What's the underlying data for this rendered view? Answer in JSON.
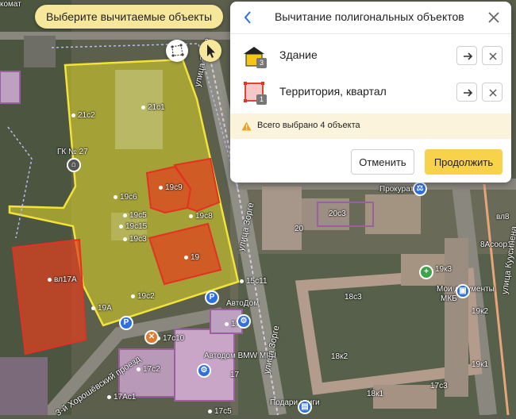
{
  "hint": "Выберите вычитаемые объекты",
  "panel": {
    "title": "Вычитание полигональных объектов",
    "items": [
      {
        "label": "Здание",
        "count": "3",
        "icon": "building-icon"
      },
      {
        "label": "Территория, квартал",
        "count": "1",
        "icon": "territory-icon"
      }
    ],
    "warning": "Всего выбрано 4 объекта",
    "cancel": "Отменить",
    "continue": "Продолжить"
  },
  "colors": {
    "accent": "#f7d24a",
    "hint_bg": "#f6e79a",
    "link_blue": "#2f6fde",
    "subtract_red": "#e0401f",
    "selection_yellow": "#f2e23a"
  },
  "map": {
    "labels": {
      "kommat": "комат",
      "gk27": "ГК № 27",
      "b21c1": "21с1",
      "b21c2": "21с2",
      "b19c6": "19с6",
      "b19c5": "19с5",
      "b19c15": "19с15",
      "b19c3": "19с3",
      "b19c8": "19с8",
      "b19c9": "19с9",
      "b19": "19",
      "b19c2": "19с2",
      "b19a": "19А",
      "b15c11": "15с11",
      "vl17a": "вл17А",
      "b17c2a": "17с2",
      "b17c10": "17с10",
      "b17c2b": "17с2",
      "b17": "17",
      "b17ac1": "17Ас1",
      "b17c5": "17с5",
      "b20": "20",
      "b20c3": "20с3",
      "b18c3": "18с3",
      "b18k2": "18к2",
      "b18k1": "18к1",
      "b17c3": "17с3",
      "b19k3": "19к3",
      "b19k2": "19к2",
      "b19k1": "19к1",
      "b8acoor": "8Асоор1",
      "b8": "вл8",
      "avtodom": "АвтоДом",
      "bmw": "Автодом BMW MINI",
      "prokuratura": "Прокуратура",
      "moi_docs": "Мои документы",
      "mkb": "МКБ",
      "podari": "Подари книги"
    },
    "streets": {
      "zorge1": "улица Зорге",
      "zorge2": "улица Зорге",
      "zorge3": "улица Зорге",
      "proezd": "3-й Хорошёвский проезд",
      "kuusinen": "улица Куусинена"
    }
  }
}
